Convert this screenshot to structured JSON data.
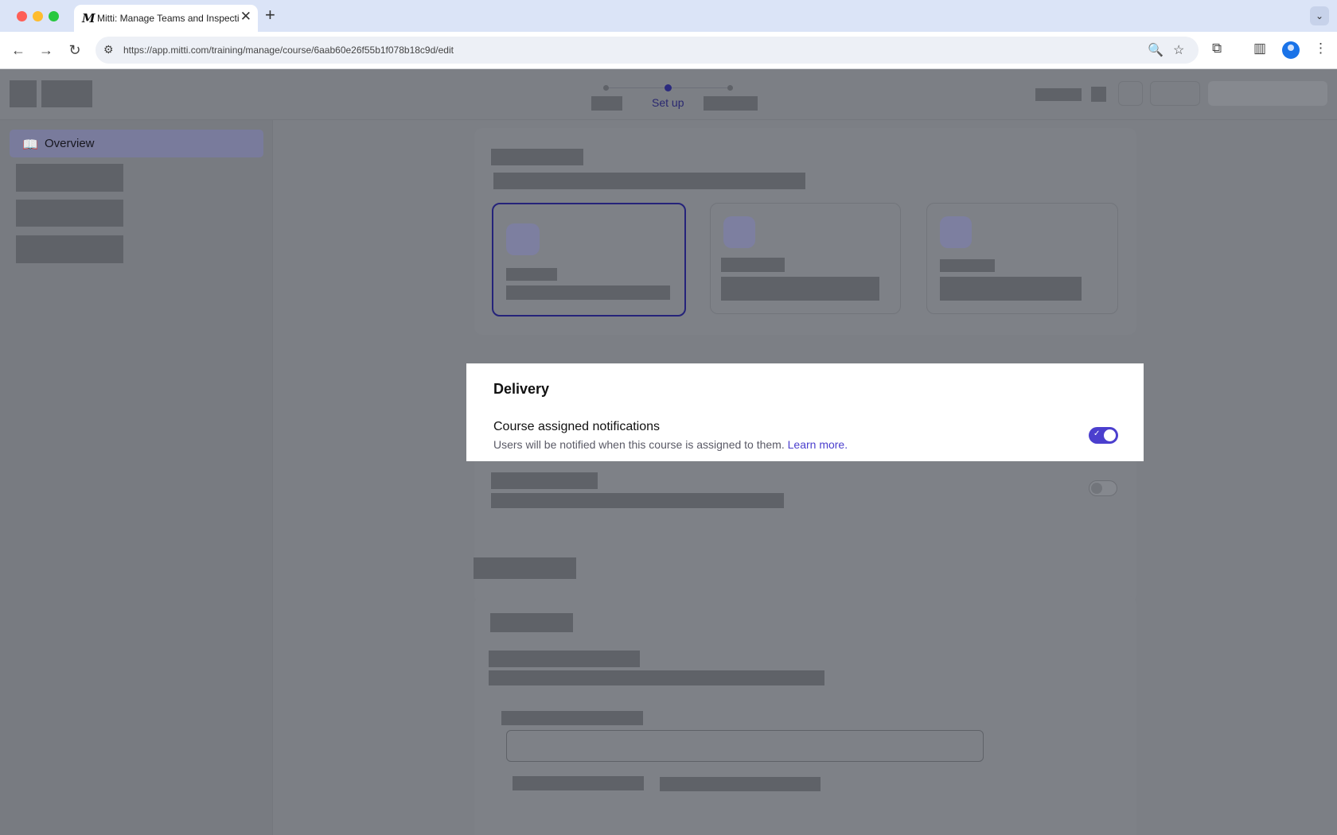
{
  "browser": {
    "tab_title": "Mitti: Manage Teams and Inspection",
    "tab_favicon": "M",
    "url": "https://app.mitti.com/training/manage/course/6aab60e26f55b1f078b18c9d/edit",
    "icons": {
      "back": "←",
      "forward": "→",
      "reload": "↻",
      "site_info": "⚙",
      "zoom": "🔍",
      "bookmark": "☆",
      "extensions": "⧉",
      "sidebar": "▥",
      "menu": "⋮",
      "new_tab": "+",
      "close": "✕",
      "tab_menu": "⌄"
    }
  },
  "stepper": {
    "active_step": "Set up"
  },
  "sidebar": {
    "active_item": {
      "label": "Overview",
      "icon": "📖"
    }
  },
  "delivery": {
    "title": "Delivery",
    "notification_label": "Course assigned notifications",
    "notification_desc": "Users will be notified when this course is assigned to them.",
    "learn_more": "Learn more.",
    "toggle_check": "✓",
    "accent_color": "#4b3fce"
  }
}
